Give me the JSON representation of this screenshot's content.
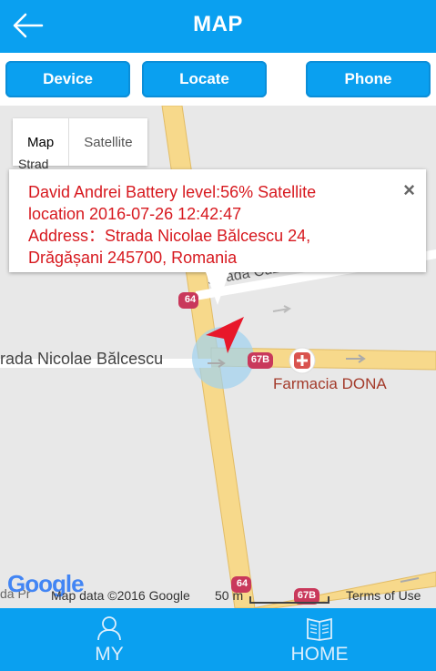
{
  "header": {
    "title": "MAP"
  },
  "buttons": {
    "device": "Device",
    "locate": "Locate",
    "phone": "Phone"
  },
  "map": {
    "type_map": "Map",
    "type_satellite": "Satellite",
    "labels": {
      "top_left": "Strad",
      "street_cuza": "Strada Cuza V",
      "street_balcescu": "rada Nicolae Bălcescu",
      "pharmacy": "Farmacia DONA",
      "route_64": "64",
      "route_67b": "67B",
      "bottom_left": "da Pr",
      "google": "Google"
    },
    "attribution": {
      "data": "Map data ©2016 Google",
      "scale": "50 m",
      "terms": "Terms of Use"
    }
  },
  "popup": {
    "line1": "David Andrei    Battery level:56%   Satellite",
    "line2": "location  2016-07-26 12:42:47",
    "line3": "Address：Strada Nicolae Bălcescu 24,",
    "line4": "Drăgășani 245700, Romania",
    "close": "×"
  },
  "tabs": {
    "my": "MY",
    "home": "HOME"
  },
  "colors": {
    "primary": "#0aa0f0",
    "alert_text": "#d7191f",
    "road": "#f7d98b",
    "road_border": "#e2bc65"
  }
}
